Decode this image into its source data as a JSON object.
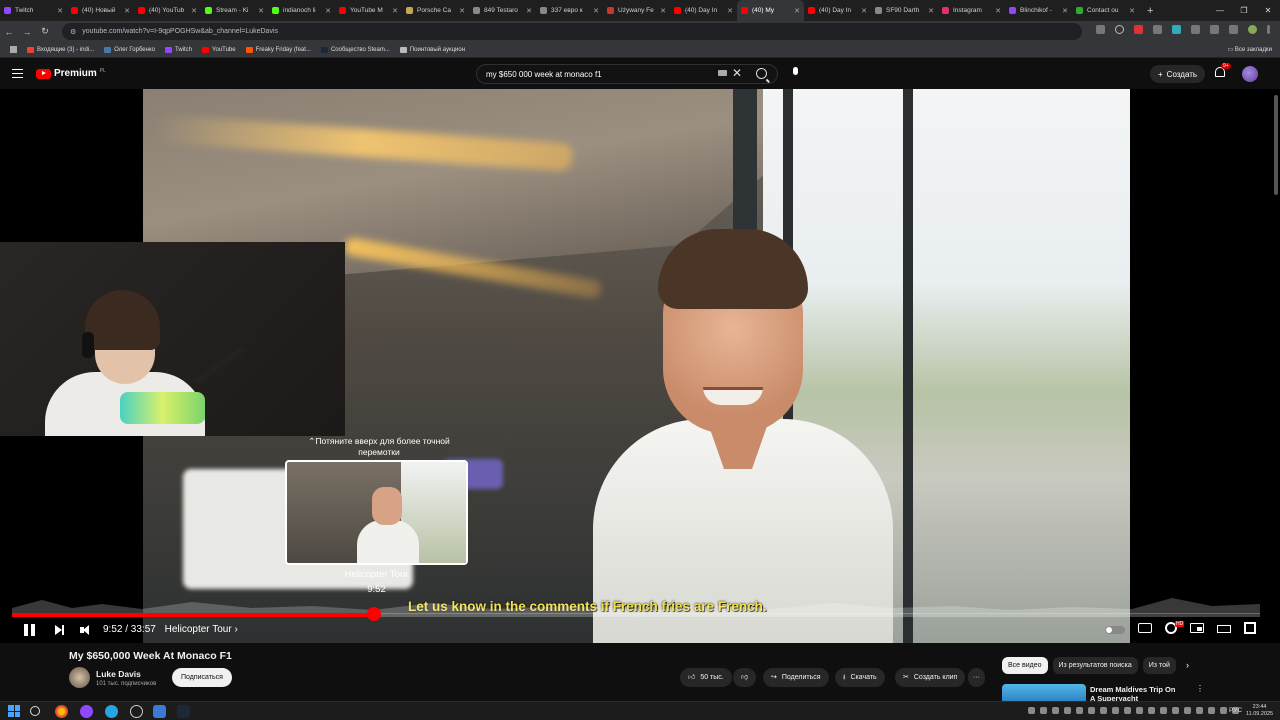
{
  "browser": {
    "tabs": [
      {
        "title": "Twitch",
        "color": "#9146ff"
      },
      {
        "title": "(40) Новый",
        "color": "#ff0000"
      },
      {
        "title": "(40) YouTub",
        "color": "#ff0000"
      },
      {
        "title": "Stream - Ki",
        "color": "#53fc18"
      },
      {
        "title": "indianoch li",
        "color": "#53fc18"
      },
      {
        "title": "YouTube M",
        "color": "#ff0000"
      },
      {
        "title": "Porsche Ca",
        "color": "#c8a45a"
      },
      {
        "title": "849 Testaro",
        "color": "#888888"
      },
      {
        "title": "337 евро к",
        "color": "#888888"
      },
      {
        "title": "Używany Fe",
        "color": "#cc3333"
      },
      {
        "title": "(40) Day In",
        "color": "#ff0000"
      },
      {
        "title": "(40) My",
        "color": "#ff0000",
        "active": true
      },
      {
        "title": "(40) Day In",
        "color": "#ff0000"
      },
      {
        "title": "SF90 Darth",
        "color": "#888888"
      },
      {
        "title": "Instagram",
        "color": "#e1306c"
      },
      {
        "title": "Blinchikof -",
        "color": "#9146ff"
      },
      {
        "title": "Contact ou",
        "color": "#33aa33"
      }
    ],
    "new_tab": "+",
    "url": "youtube.com/watch?v=I-9qpPOGHSw&ab_channel=LukeDavis",
    "bookmarks": [
      {
        "label": "Входящие (3) - indi...",
        "color": "#ea4335"
      },
      {
        "label": "Олег Горбенко",
        "color": "#4a76a8"
      },
      {
        "label": "Twitch",
        "color": "#9146ff"
      },
      {
        "label": "YouTube",
        "color": "#ff0000"
      },
      {
        "label": "Freaky Friday (feat...",
        "color": "#ff5500"
      },
      {
        "label": "Сообщество Steam...",
        "color": "#1b2838"
      },
      {
        "label": "Поинтовый аукцион",
        "color": "#bbbbbb"
      }
    ],
    "all_bookmarks": "Все закладки"
  },
  "youtube": {
    "logo_text": "Premium",
    "logo_region": "PL",
    "search_value": "my $650 000 week at monaco f1",
    "create_label": "Создать",
    "notifications_badge": "9+"
  },
  "player": {
    "drag_hint": "Потяните вверх для более точной перемотки",
    "preview_chapter": "Helicopter Tour",
    "preview_time": "9:52",
    "caption": "Let us know in the comments if French fries are French.",
    "current_time": "9:52",
    "duration": "33:57",
    "time_display": "9:52 / 33:57",
    "chapter_display": "Helicopter Tour ›",
    "progress_fraction": 0.29,
    "hd_badge": "HD"
  },
  "video": {
    "title": "My $650,000 Week At Monaco F1",
    "channel": "Luke Davis",
    "subscribers": "101 тыс. подписчиков",
    "subscribe_label": "Подписаться",
    "likes": "50 тыс.",
    "share_label": "Поделиться",
    "download_label": "Скачать",
    "clip_label": "Создать клип",
    "more_label": "···"
  },
  "sidebar": {
    "chips": [
      "Все видео",
      "Из результатов поиска",
      "Из той"
    ],
    "rec_title": "Dream Maldives Trip On A Superyacht"
  },
  "taskbar": {
    "lang": "РУС",
    "time": "23:44",
    "date": "11.09.2025"
  }
}
